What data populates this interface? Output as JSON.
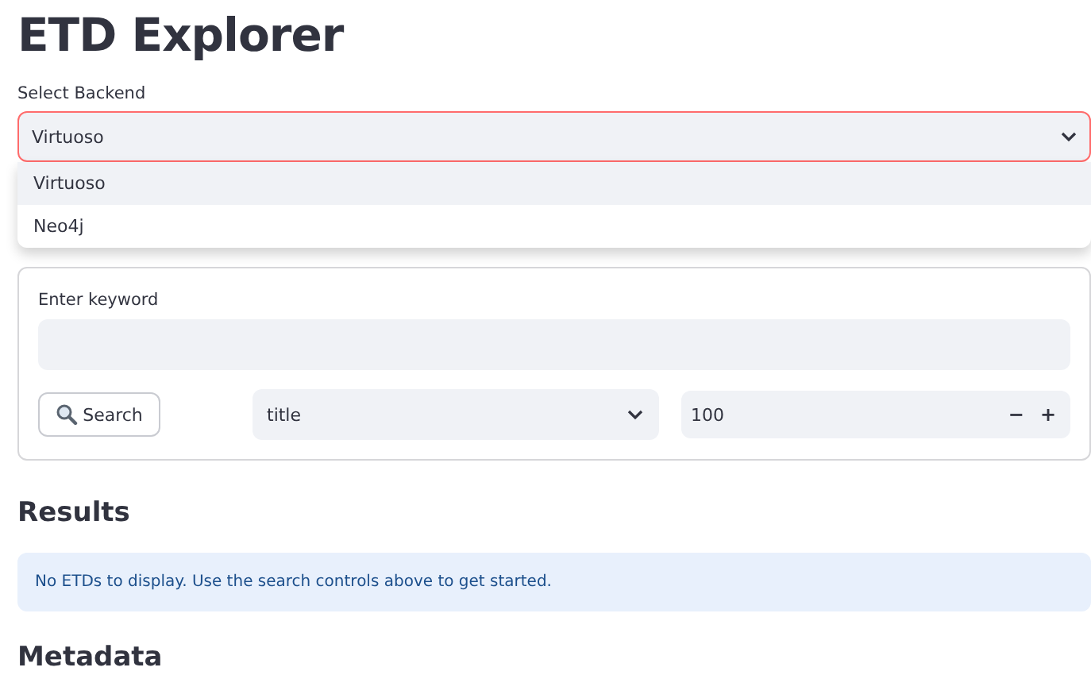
{
  "title": "ETD Explorer",
  "backend": {
    "label": "Select Backend",
    "value": "Virtuoso",
    "expanded": true,
    "options": [
      {
        "label": "Virtuoso",
        "selected": true
      },
      {
        "label": "Neo4j",
        "selected": false
      }
    ]
  },
  "search_form": {
    "keyword_label": "Enter keyword",
    "search_button": "Search",
    "field": "title",
    "limit": "100",
    "decrement": "−",
    "increment": "+"
  },
  "results": {
    "heading": "Results",
    "info": "No ETDs to display. Use the search controls above to get started."
  },
  "metadata": {
    "heading": "Metadata"
  }
}
